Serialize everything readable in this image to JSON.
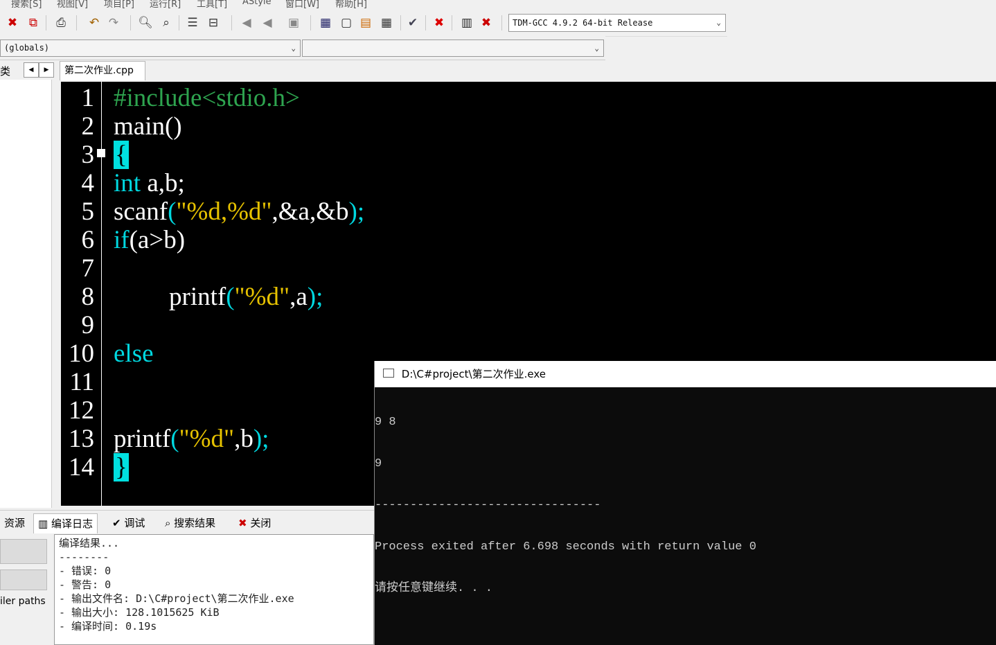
{
  "menu": [
    "搜索[S]",
    "视图[V]",
    "项目[P]",
    "运行[R]",
    "工具[T]",
    "AStyle",
    "窗口[W]",
    "帮助[H]"
  ],
  "toolbar": {
    "compiler_select": "TDM-GCC 4.9.2 64-bit Release",
    "scope_select": "(globals)",
    "member_select": ""
  },
  "left_panel": {
    "tab_label": "类",
    "compiler_paths_label": "iler paths"
  },
  "editor": {
    "file_tab": "第二次作业.cpp",
    "line_numbers": [
      "1",
      "2",
      "3",
      "4",
      "5",
      "6",
      "7",
      "8",
      "9",
      "10",
      "11",
      "12",
      "13",
      "14"
    ],
    "code": {
      "l1": "#include<stdio.h>",
      "l2": "main()",
      "l3": "{",
      "l4_kw": "int",
      "l4_rest": " a,b;",
      "l5_fn": "scanf",
      "l5_p1": "(",
      "l5_str": "\"%d,%d\"",
      "l5_args": ",&a,&b",
      "l5_end": ");",
      "l6_kw": "if",
      "l6_rest": "(a>b)",
      "l8_fn": "printf",
      "l8_p1": "(",
      "l8_str": "\"%d\"",
      "l8_args": ",a",
      "l8_end": ");",
      "l10_kw": "else",
      "l13_fn": "printf",
      "l13_p1": "(",
      "l13_str": "\"%d\"",
      "l13_args": ",b",
      "l13_end": ");",
      "l14": "}"
    }
  },
  "bottom_tabs": [
    "资源",
    "编译日志",
    "调试",
    "搜索结果",
    "关闭"
  ],
  "compile_log": [
    "编译结果...",
    "--------",
    "- 错误: 0",
    "- 警告: 0",
    "- 输出文件名: D:\\C#project\\第二次作业.exe",
    "- 输出大小: 128.1015625 KiB",
    "- 编译时间: 0.19s"
  ],
  "console": {
    "title": "D:\\C#project\\第二次作业.exe",
    "lines": [
      "9 8",
      "9",
      "--------------------------------",
      "Process exited after 6.698 seconds with return value 0",
      "请按任意键继续. . ."
    ]
  },
  "colors": {
    "editor_bg": "#000000",
    "keyword": "#00d8e0",
    "string": "#e6c200",
    "preprocessor": "#2ea44f",
    "brace_highlight": "#00e0e0"
  }
}
